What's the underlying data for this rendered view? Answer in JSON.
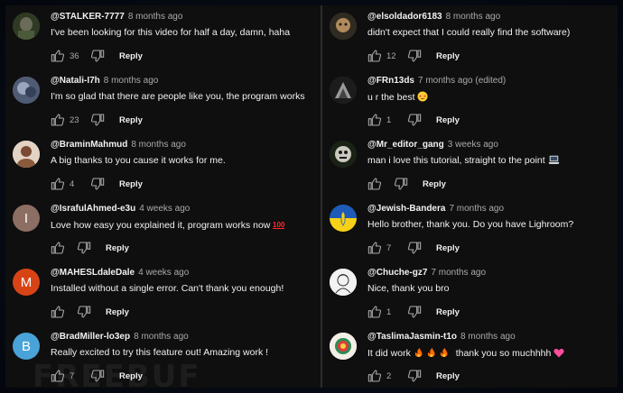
{
  "left_comments": [
    {
      "handle": "@STALKER-7777",
      "time": "8 months ago",
      "text": "I've been looking for this video for half a day, damn, haha",
      "likes": "36",
      "reply": "Reply",
      "avatar_letter": "",
      "avatar_color": "#3a4a2e",
      "avatar_icon": "photo-avatar"
    },
    {
      "handle": "@Natali-I7h",
      "time": "8 months ago",
      "text": "I'm so glad that there are people like you, the program works",
      "likes": "23",
      "reply": "Reply",
      "avatar_letter": "",
      "avatar_color": "#55627a",
      "avatar_icon": "photo-avatar"
    },
    {
      "handle": "@BraminMahmud",
      "time": "8 months ago",
      "text": "A big thanks to you cause it works for me.",
      "likes": "4",
      "reply": "Reply",
      "avatar_letter": "",
      "avatar_color": "#d9c7b8",
      "avatar_icon": "photo-avatar"
    },
    {
      "handle": "@IsrafulAhmed-e3u",
      "time": "4 weeks ago",
      "text": "Love how easy you explained it, program works now",
      "likes": "",
      "reply": "Reply",
      "avatar_letter": "I",
      "avatar_color": "#8d6e63",
      "avatar_icon": "letter-avatar"
    },
    {
      "handle": "@MAHESLdaleDale",
      "time": "4 weeks ago",
      "text": "Installed without a single error. Can't thank you enough!",
      "likes": "",
      "reply": "Reply",
      "avatar_letter": "M",
      "avatar_color": "#d84315",
      "avatar_icon": "letter-avatar"
    },
    {
      "handle": "@BradMiller-lo3ep",
      "time": "8 months ago",
      "text": "Really excited to try this feature out! Amazing work !",
      "likes": "7",
      "reply": "Reply",
      "avatar_letter": "B",
      "avatar_color": "#4aa3d8",
      "avatar_icon": "letter-avatar"
    }
  ],
  "right_comments": [
    {
      "handle": "@elsoldador6183",
      "time": "8 months ago",
      "text": "didn't expect that I could really find the software)",
      "likes": "12",
      "reply": "Reply",
      "avatar_letter": "",
      "avatar_color": "#3b3b3b",
      "avatar_icon": "photo-avatar"
    },
    {
      "handle": "@FRn13ds",
      "time": "7 months ago (edited)",
      "text": "u r the best",
      "likes": "1",
      "reply": "Reply",
      "avatar_letter": "",
      "avatar_color": "#2c2c2c",
      "avatar_icon": "photo-avatar"
    },
    {
      "handle": "@Mr_editor_gang",
      "time": "3 weeks ago",
      "text": "man i love this tutorial, straight to the point",
      "likes": "",
      "reply": "Reply",
      "avatar_letter": "",
      "avatar_color": "#1f2a1a",
      "avatar_icon": "photo-avatar"
    },
    {
      "handle": "@Jewish-Bandera",
      "time": "7 months ago",
      "text": "Hello brother, thank you. Do you have Lighroom?",
      "likes": "7",
      "reply": "Reply",
      "avatar_letter": "",
      "avatar_color": "#1e5bb8",
      "avatar_icon": "flag-avatar"
    },
    {
      "handle": "@Chuche-gz7",
      "time": "7 months ago",
      "text": "Nice, thank you bro",
      "likes": "1",
      "reply": "Reply",
      "avatar_letter": "",
      "avatar_color": "#f2f2f2",
      "avatar_icon": "sketch-avatar"
    },
    {
      "handle": "@TaslimaJasmin-t1o",
      "time": "8 months ago",
      "text": "It did work",
      "text_after": "thank you so muchhhh",
      "likes": "2",
      "reply": "Reply",
      "avatar_letter": "",
      "avatar_color": "#f3efe6",
      "avatar_icon": "badge-avatar"
    }
  ],
  "watermark": "FREEBUF"
}
